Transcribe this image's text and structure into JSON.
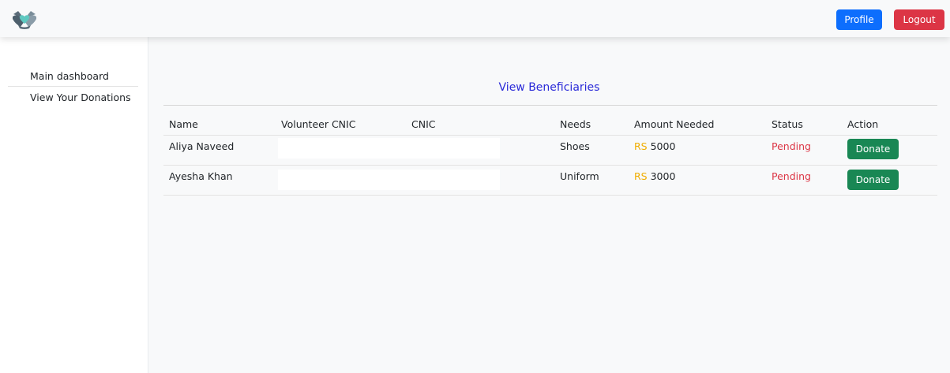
{
  "navbar": {
    "logo_icon": "helping-hands-heart-icon",
    "profile_label": "Profile",
    "logout_label": "Logout",
    "profile_color": "#0d6efd",
    "logout_color": "#dc3545"
  },
  "sidebar": {
    "items": [
      {
        "label": "Main dashboard"
      },
      {
        "label": "View Your Donations"
      }
    ]
  },
  "main": {
    "title": "View Beneficiaries",
    "table": {
      "headers": [
        "Name",
        "Volunteer CNIC",
        "CNIC",
        "Needs",
        "Amount Needed",
        "Status",
        "Action"
      ],
      "rows": [
        {
          "name": "Aliya Naveed",
          "volunteer_cnic": "",
          "cnic": "",
          "needs": "Shoes",
          "currency": "RS",
          "amount": "5000",
          "status": "Pending",
          "action": "Donate"
        },
        {
          "name": "Ayesha Khan",
          "volunteer_cnic": "",
          "cnic": "",
          "needs": "Uniform",
          "currency": "RS",
          "amount": "3000",
          "status": "Pending",
          "action": "Donate"
        }
      ]
    }
  }
}
